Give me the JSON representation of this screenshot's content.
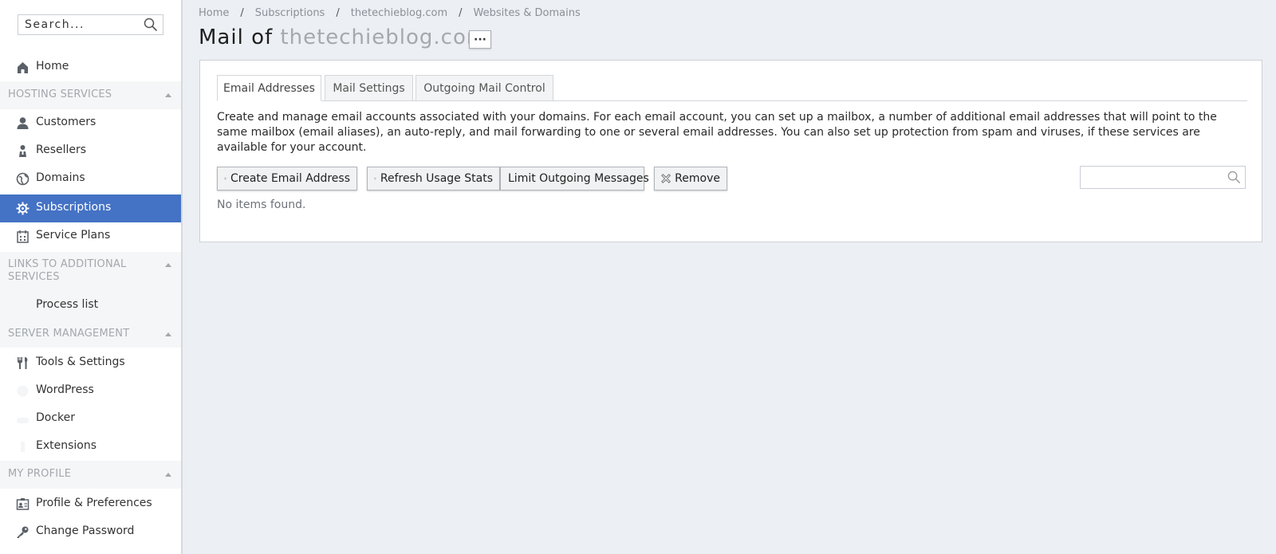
{
  "sidebar": {
    "search_placeholder": "Search...",
    "items": {
      "home": "Home",
      "customers": "Customers",
      "resellers": "Resellers",
      "domains": "Domains",
      "subscriptions": "Subscriptions",
      "service_plans": "Service Plans",
      "process_list": "Process list",
      "tools_settings": "Tools & Settings",
      "wordpress": "WordPress",
      "docker": "Docker",
      "extensions": "Extensions",
      "profile_preferences": "Profile & Preferences",
      "change_password": "Change Password"
    },
    "sections": {
      "hosting": "HOSTING SERVICES",
      "links": "LINKS TO ADDITIONAL SERVICES",
      "server": "SERVER MANAGEMENT",
      "profile": "MY PROFILE"
    },
    "active_item": "Subscriptions"
  },
  "breadcrumb": [
    "Home",
    "Subscriptions",
    "thetechieblog.com",
    "Websites & Domains"
  ],
  "page": {
    "title_prefix": "Mail of",
    "title_domain": "thetechieblog.com",
    "more_label": "···"
  },
  "tabs": [
    "Email Addresses",
    "Mail Settings",
    "Outgoing Mail Control"
  ],
  "description": "Create and manage email accounts associated with your domains. For each email account, you can set up a mailbox, a number of additional email addresses that will point to the same mailbox (email aliases), an auto-reply, and mail forwarding to one or several email addresses. You can also set up protection from spam and viruses, if these services are available for your account.",
  "toolbar": {
    "create": "Create Email Address",
    "refresh": "Refresh Usage Stats",
    "limit": "Limit Outgoing Messages",
    "remove": "Remove"
  },
  "list_search_value": "",
  "empty_message": "No items found.",
  "colors": {
    "active_nav": "#4472c4",
    "background": "#eceff3",
    "muted_text": "#a3a8ae"
  }
}
